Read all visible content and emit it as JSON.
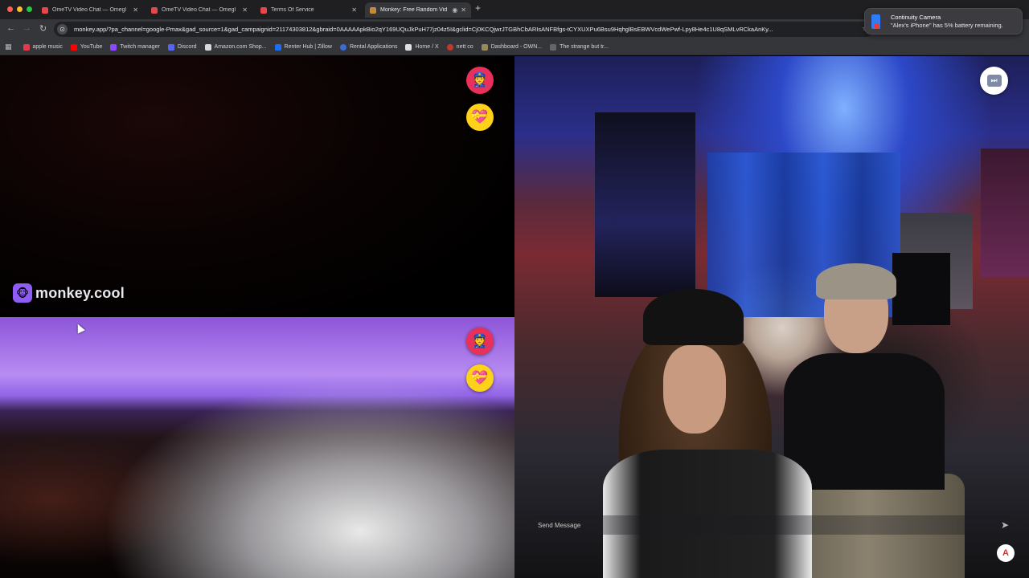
{
  "browser": {
    "tabs": [
      {
        "title": "OmeTV Video Chat — Omegl",
        "active": false
      },
      {
        "title": "OmeTV Video Chat — Omegl",
        "active": false
      },
      {
        "title": "Terms Of Service",
        "active": false
      },
      {
        "title": "Monkey: Free Random Vid",
        "active": true
      }
    ],
    "new_tab": "+",
    "url": "monkey.app/?pa_channel=google-Pmax&gad_source=1&gad_campaignid=21174303812&gbraid=0AAAAApkBio2qY169UQuJkPuH77jz04z5I&gclid=Cj0KCQjwrJTGBhCbARIsANFBfgs-tCYXUXPu6Bsu9HqhglBsEBWVcdWePwf-Lpy8He4c1U8qSMLvRCkaAnKy...",
    "bookmarks": [
      {
        "label": "apple music",
        "color": "#e5394b"
      },
      {
        "label": "YouTube",
        "color": "#ff0000"
      },
      {
        "label": "Twitch manager",
        "color": "#9146ff"
      },
      {
        "label": "Discord",
        "color": "#5865f2"
      },
      {
        "label": "Amazon.com Shop...",
        "color": "#222222"
      },
      {
        "label": "Renter Hub | Zillow",
        "color": "#1a6ef5"
      },
      {
        "label": "Rental Applications",
        "color": "#3b6bd6"
      },
      {
        "label": "Home / X",
        "color": "#000000"
      },
      {
        "label": "nett co",
        "color": "#c0392b"
      },
      {
        "label": "Dashboard - OWN...",
        "color": "#888888"
      },
      {
        "label": "The strange but tr...",
        "color": "#555555"
      }
    ]
  },
  "notification": {
    "title": "Continuity Camera",
    "body": "\"Alex's iPhone\" has 5% battery remaining."
  },
  "app": {
    "brand": "monkey.cool",
    "message_placeholder": "Send Message",
    "colors": {
      "report": "#e8305a",
      "heart": "#ffd21a",
      "brand": "#8f5cf6"
    }
  },
  "icons": {
    "report": "police-officer-icon",
    "heart": "heart-gift-icon",
    "skip": "skip-forward-icon",
    "send": "send-arrow-icon",
    "corner": "adobe-acrobat-icon"
  }
}
